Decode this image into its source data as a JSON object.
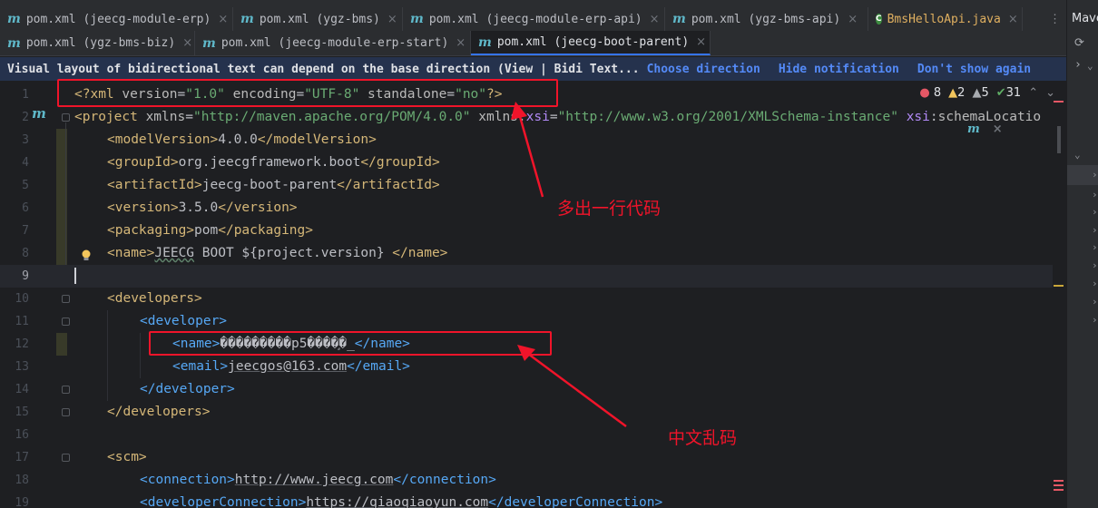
{
  "tabs_row1": [
    {
      "label": "pom.xml (jeecg-module-erp)",
      "icon": "maven-icon"
    },
    {
      "label": "pom.xml (ygz-bms)",
      "icon": "maven-icon"
    },
    {
      "label": "pom.xml (jeecg-module-erp-api)",
      "icon": "maven-icon"
    },
    {
      "label": "pom.xml (ygz-bms-api)",
      "icon": "maven-icon"
    },
    {
      "label": "BmsHelloApi.java",
      "icon": "java-class-icon"
    }
  ],
  "tabs_row2": [
    {
      "label": "pom.xml (ygz-bms-biz)",
      "icon": "maven-icon"
    },
    {
      "label": "pom.xml (jeecg-module-erp-start)",
      "icon": "maven-icon"
    },
    {
      "label": "pom.xml (jeecg-boot-parent)",
      "icon": "maven-icon",
      "active": true
    }
  ],
  "tab_close_glyph": "×",
  "tab_more_glyph": "⋮",
  "banner": {
    "text": "Visual layout of bidirectional text can depend on the base direction (View | Bidi Text...",
    "choose": "Choose direction",
    "hide": "Hide notification",
    "dont_show": "Don't show again"
  },
  "inspections": {
    "errors": "8",
    "warnings": "2",
    "weak_warnings": "5",
    "ok": "31"
  },
  "line_numbers": [
    "1",
    "2",
    "3",
    "4",
    "5",
    "6",
    "7",
    "8",
    "9",
    "10",
    "11",
    "12",
    "13",
    "14",
    "15",
    "16",
    "17",
    "18",
    "19"
  ],
  "code": {
    "l1": {
      "pi_open": "<?xml ",
      "a1": "version",
      "v1": "\"1.0\"",
      "a2": "encoding",
      "v2": "\"UTF-8\"",
      "a3": "standalone",
      "v3": "\"no\"",
      "pi_close": "?>"
    },
    "l2": {
      "tag": "<project ",
      "a1": "xmlns",
      "v1": "\"http://maven.apache.org/POM/4.0.0\"",
      "ns1": "xmlns",
      "a2": "xsi",
      "v2": "\"http://www.w3.org/2001/XMLSchema-instance\"",
      "ns2": "xsi",
      "a3": "schemaLocatio"
    },
    "l3": {
      "open": "<modelVersion>",
      "text": "4.0.0",
      "close": "</modelVersion>"
    },
    "l4": {
      "open": "<groupId>",
      "text": "org.jeecgframework.boot",
      "close": "</groupId>"
    },
    "l5": {
      "open": "<artifactId>",
      "text": "jeecg-boot-parent",
      "close": "</artifactId>"
    },
    "l6": {
      "open": "<version>",
      "text": "3.5.0",
      "close": "</version>"
    },
    "l7": {
      "open": "<packaging>",
      "text": "pom",
      "close": "</packaging>"
    },
    "l8": {
      "open": "<name>",
      "text1": "JEECG",
      "text2": " BOOT ${project.version} ",
      "close": "</name>"
    },
    "l10": {
      "open": "<developers>"
    },
    "l11": {
      "open": "<developer>"
    },
    "l12": {
      "open": "<name>",
      "text": "���������p5����֣�_",
      "close": "</name>"
    },
    "l13": {
      "open": "<email>",
      "text": "jeecgos@163.com",
      "close": "</email>"
    },
    "l14": {
      "close": "</developer>"
    },
    "l15": {
      "close": "</developers>"
    },
    "l17": {
      "open": "<scm>"
    },
    "l18": {
      "open": "<connection>",
      "text": "http://www.jeecg.com",
      "close": "</connection>"
    },
    "l19": {
      "open": "<developerConnection>",
      "text": "https://qiaoqiaoyun.com",
      "close": "</developerConnection>"
    }
  },
  "annotations": {
    "extra_line": "多出一行代码",
    "garbled": "中文乱码"
  },
  "right_panel": {
    "title": "Maven"
  },
  "colors": {
    "annotation_red": "#f0142a",
    "accent_blue": "#3574f0",
    "banner_bg": "#25324d"
  }
}
